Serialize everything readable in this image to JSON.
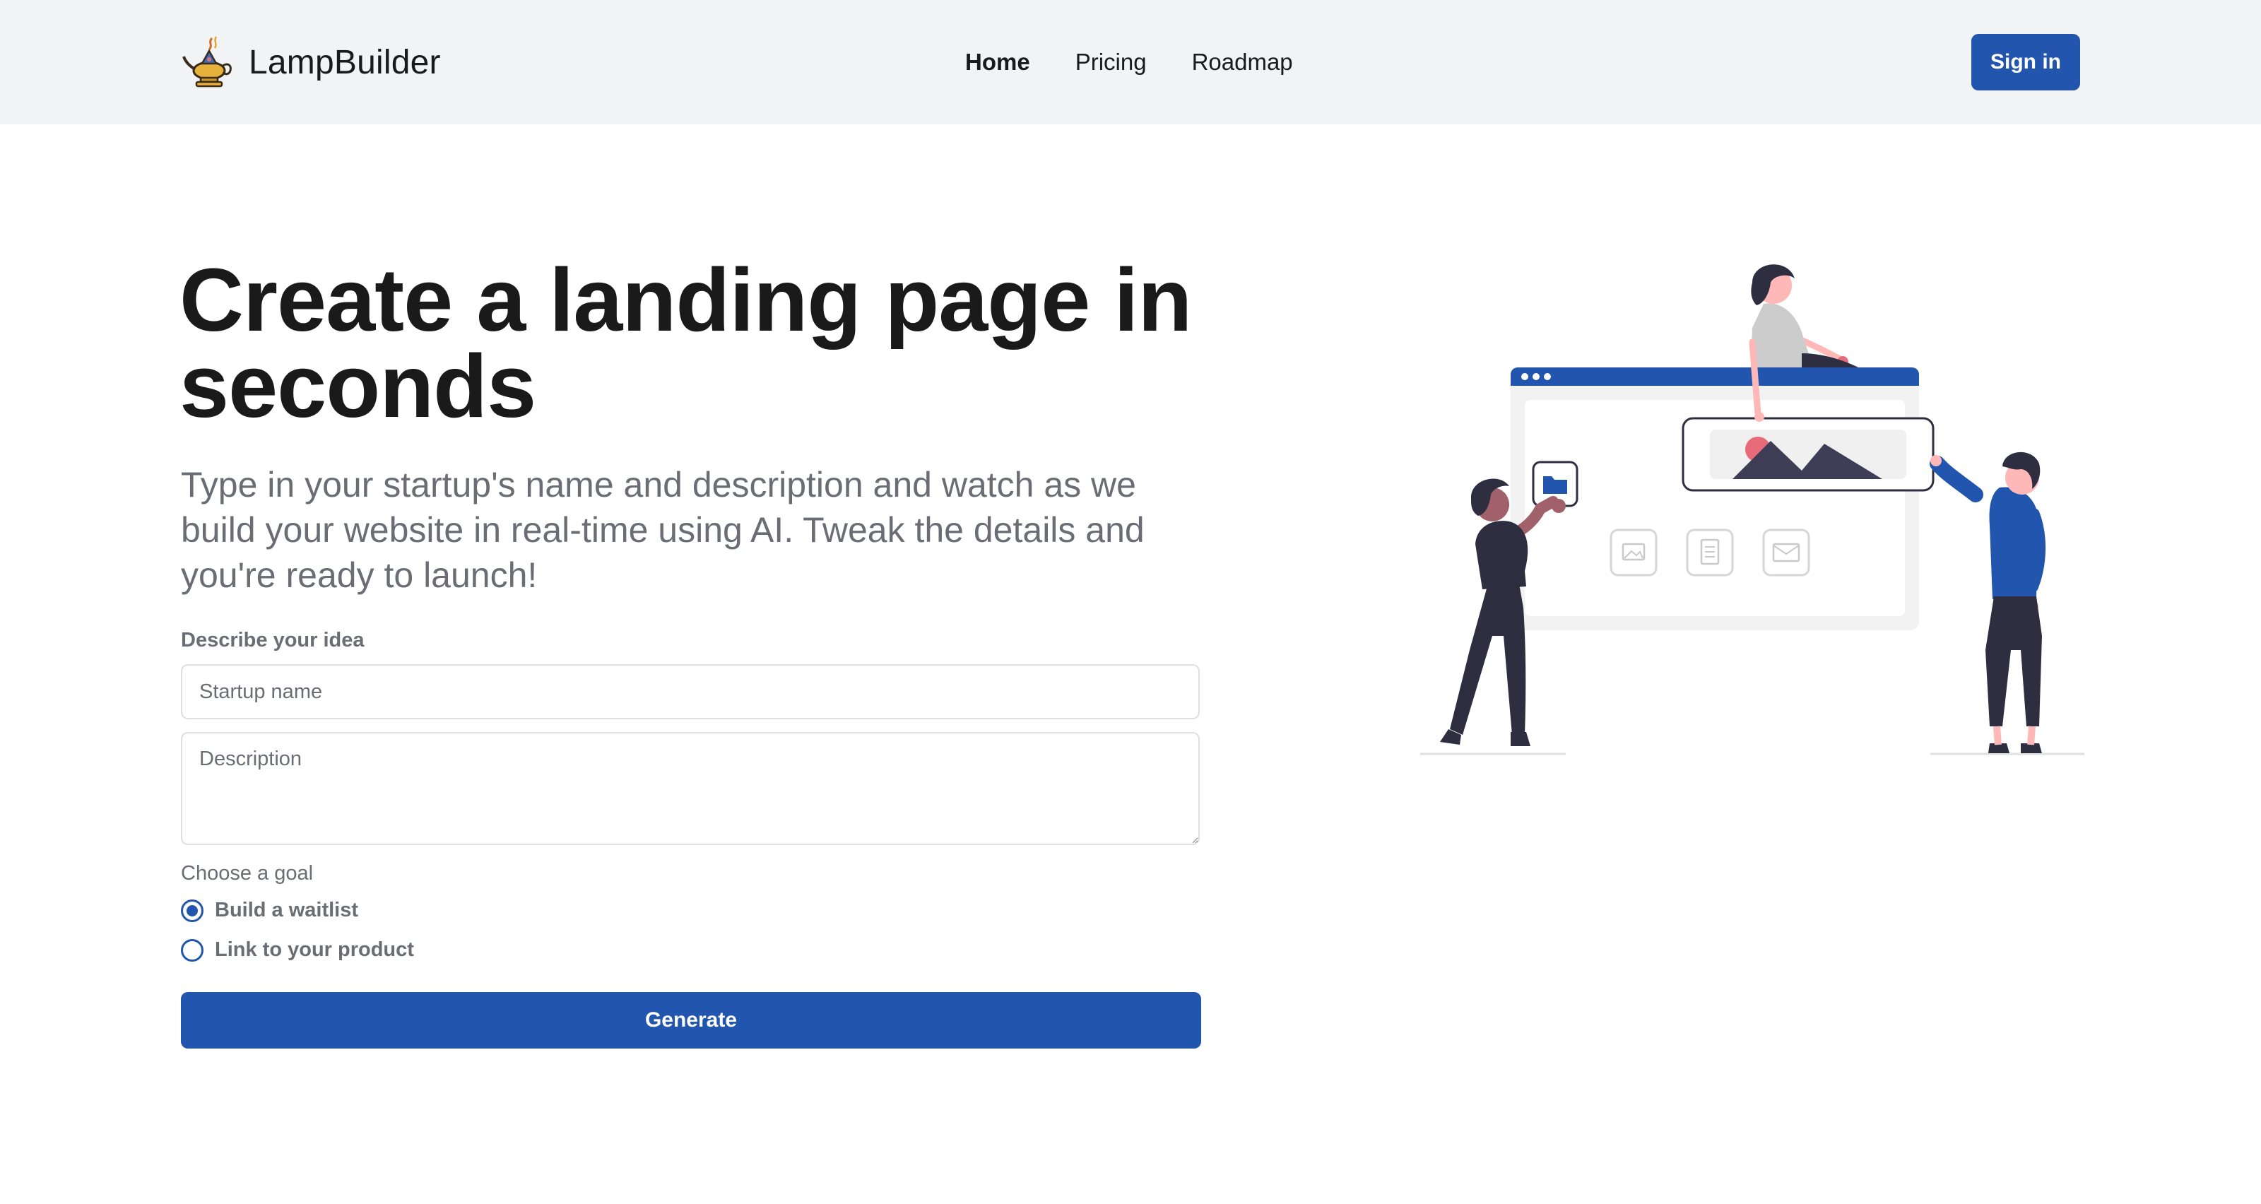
{
  "header": {
    "brand_name": "LampBuilder",
    "brand_icon": "genie-lamp-logo",
    "nav": [
      {
        "label": "Home",
        "active": true
      },
      {
        "label": "Pricing",
        "active": false
      },
      {
        "label": "Roadmap",
        "active": false
      }
    ],
    "signin_label": "Sign in"
  },
  "hero": {
    "title": "Create a landing page in seconds",
    "subtitle": "Type in your startup's name and description and watch as we build your website in real-time using AI. Tweak the details and you're ready to launch!"
  },
  "form": {
    "idea_label": "Describe your idea",
    "startup_name": {
      "value": "",
      "placeholder": "Startup name"
    },
    "description": {
      "value": "",
      "placeholder": "Description"
    },
    "goal_label": "Choose a goal",
    "goals": [
      {
        "label": "Build a waitlist",
        "selected": true
      },
      {
        "label": "Link to your product",
        "selected": false
      }
    ],
    "generate_label": "Generate"
  },
  "illustration": {
    "icons": [
      "folder-icon",
      "image-icon",
      "document-icon",
      "mail-icon",
      "mountain-image-icon"
    ]
  },
  "colors": {
    "accent": "#2255ad",
    "header_bg": "#f2f3f5",
    "muted_text": "#6a6d73",
    "illustration_pink": "#e86b7a",
    "illustration_dark": "#2f2e41"
  }
}
